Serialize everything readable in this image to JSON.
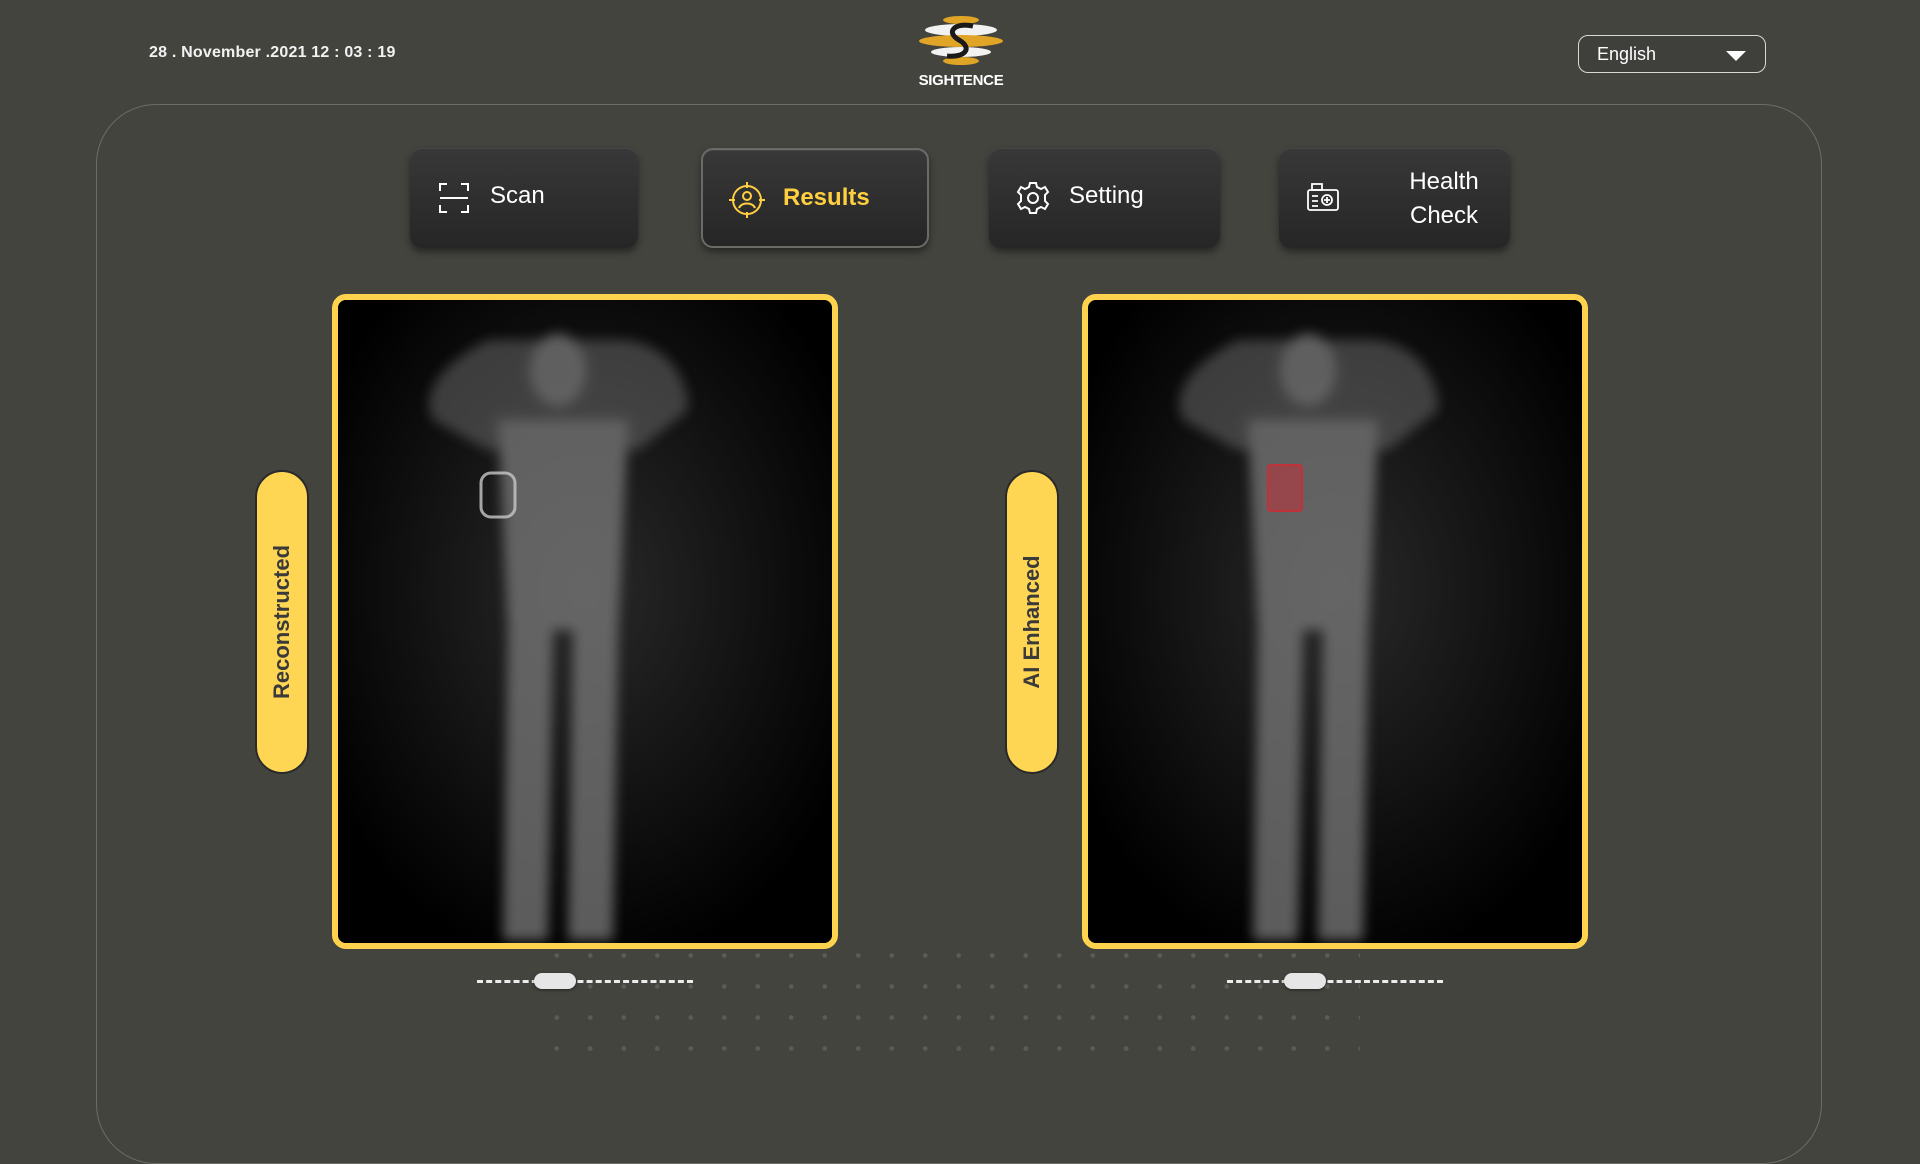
{
  "header": {
    "datetime": "28 . November .2021   12 : 03 : 19",
    "logo_text": "SIGHTENCE",
    "language": {
      "selected": "English"
    }
  },
  "nav": {
    "items": [
      {
        "label": "Scan",
        "icon": "scan-frame-icon",
        "active": false
      },
      {
        "label": "Results",
        "icon": "target-person-icon",
        "active": true
      },
      {
        "label": "Setting",
        "icon": "gear-icon",
        "active": false
      },
      {
        "label_line1": "Health",
        "label_line2": "Check",
        "icon": "health-check-device-icon",
        "active": false
      }
    ]
  },
  "views": {
    "left": {
      "label": "Reconstructed",
      "slider_value": 0.36
    },
    "right": {
      "label": "AI Enhanced",
      "slider_value": 0.36
    }
  },
  "colors": {
    "background": "#44443f",
    "accent": "#ffd34d",
    "detection_box": "#c0323a"
  }
}
